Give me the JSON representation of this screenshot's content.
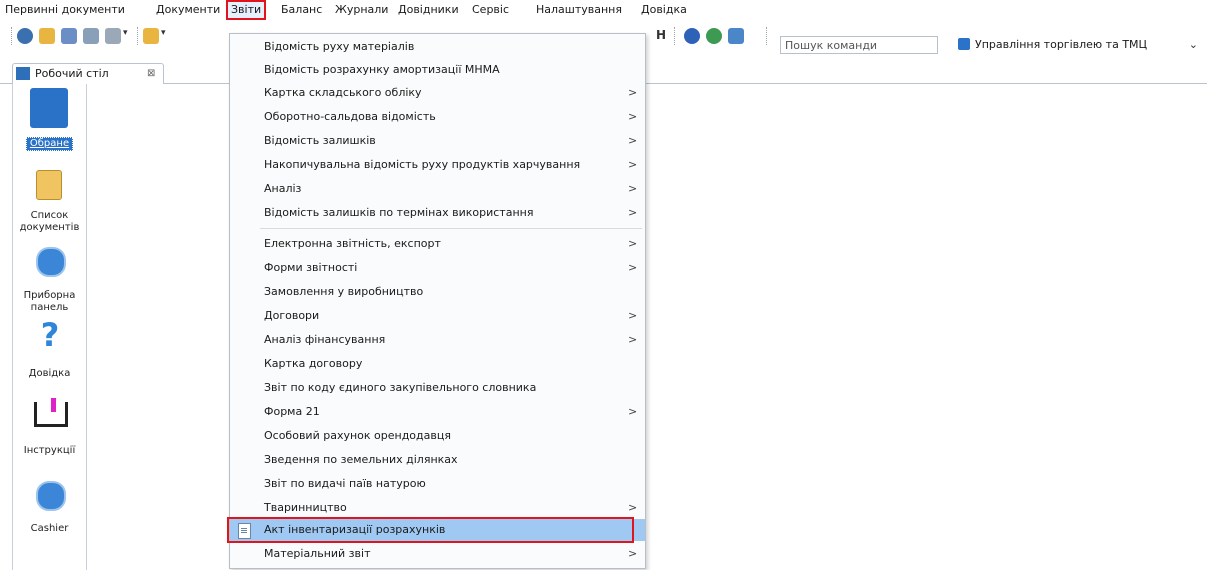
{
  "menu": {
    "items": [
      "Первинні документи",
      "Документи",
      "Звіти",
      "Баланс",
      "Журнали",
      "Довідники",
      "Сервіс",
      "Налаштування",
      "Довідка"
    ],
    "active": "Звіти"
  },
  "toolbar": {
    "search_placeholder": "Пошук команди",
    "module_select": "Управління торгівлею та ТМЦ"
  },
  "tab": {
    "label": "Робочий стіл",
    "close": "⊠"
  },
  "desktop": {
    "items": [
      {
        "label": "Обране",
        "icon": "favorites-icon"
      },
      {
        "label": "Список документів",
        "icon": "document-list-icon"
      },
      {
        "label": "Приборна панель",
        "icon": "dashboard-gear-icon"
      },
      {
        "label": "Довідка",
        "icon": "help-question-icon"
      },
      {
        "label": "Інструкції",
        "icon": "book-icon"
      },
      {
        "label": "Cashier",
        "icon": "cashier-gear-icon"
      }
    ]
  },
  "dropdown": {
    "items": [
      {
        "label": "Відомість руху матеріалів",
        "submenu": false
      },
      {
        "label": "Відомість розрахунку амортизації МНМА",
        "submenu": false
      },
      {
        "label": "Картка складського обліку",
        "submenu": true
      },
      {
        "label": "Оборотно-сальдова відомість",
        "submenu": true
      },
      {
        "label": "Відомість залишків",
        "submenu": true
      },
      {
        "label": "Накопичувальна відомість руху продуктів харчування",
        "submenu": true
      },
      {
        "label": "Аналіз",
        "submenu": true
      },
      {
        "label": "Відомість залишків по термінах використання",
        "submenu": true
      },
      {
        "label": "Електронна звітність, експорт",
        "submenu": true
      },
      {
        "label": "Форми звітності",
        "submenu": true
      },
      {
        "label": "Замовлення у виробництво",
        "submenu": false
      },
      {
        "label": "Договори",
        "submenu": true
      },
      {
        "label": "Аналіз фінансування",
        "submenu": true
      },
      {
        "label": "Картка договору",
        "submenu": false
      },
      {
        "label": "Звіт по коду єдиного закупівельного словника",
        "submenu": false
      },
      {
        "label": "Форма 21",
        "submenu": true
      },
      {
        "label": "Особовий рахунок орендодавця",
        "submenu": false
      },
      {
        "label": "Зведення по земельних ділянках",
        "submenu": false
      },
      {
        "label": "Звіт по видачі паїв натурою",
        "submenu": false
      },
      {
        "label": "Тваринництво",
        "submenu": true
      },
      {
        "label": "Акт інвентаризації розрахунків",
        "submenu": false,
        "highlighted": true
      },
      {
        "label": "Матеріальний звіт",
        "submenu": true
      }
    ],
    "arrow": ">"
  }
}
